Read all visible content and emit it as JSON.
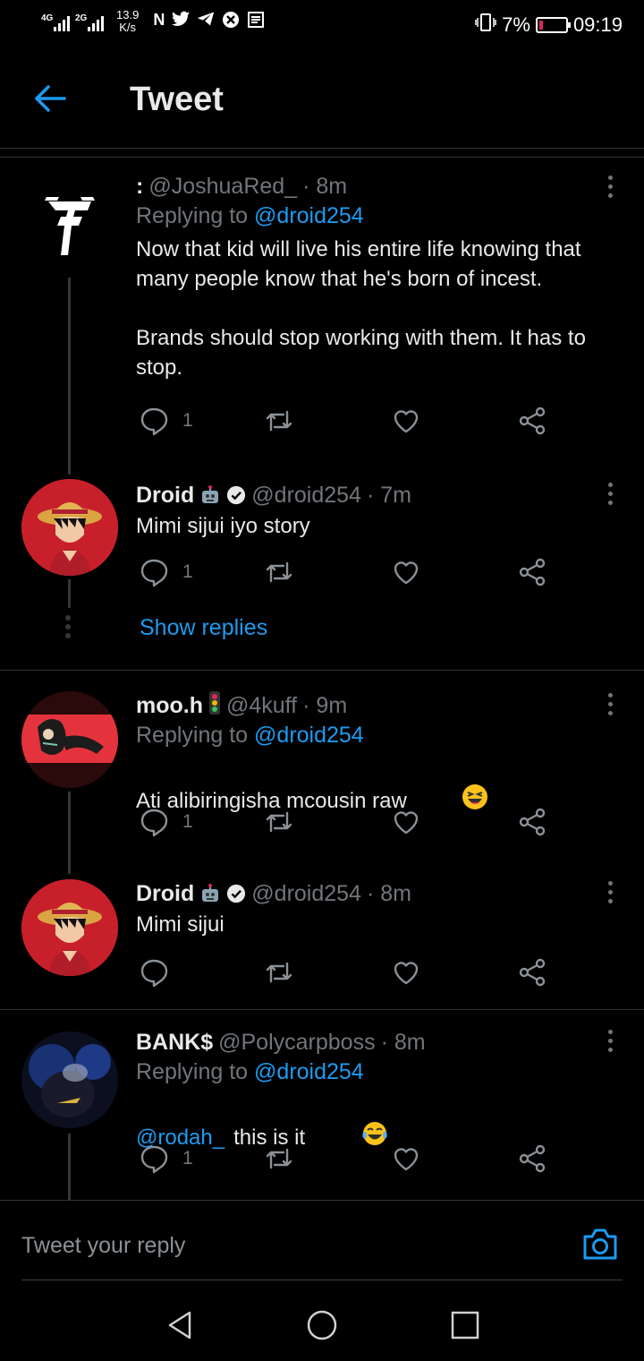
{
  "status_bar": {
    "net1": "4G",
    "net2": "2G",
    "speed_value": "13.9",
    "speed_unit": "K/s",
    "battery": "7%",
    "time": "09:19",
    "icons": [
      "n-icon",
      "twitter-icon",
      "telegram-icon",
      "blocked-icon",
      "news-icon"
    ]
  },
  "header": {
    "title": "Tweet"
  },
  "tweets": [
    {
      "name": ":",
      "handle": "@JoshuaRed_",
      "time": "· 8m",
      "replying_prefix": "Replying to",
      "replying_to": "@droid254",
      "text": "Now that kid will live his entire life knowing that many people know that he's born of incest.\n\nBrands should stop working with them. It has to stop.",
      "reply_count": "1"
    },
    {
      "name": "Droid",
      "handle": "@droid254",
      "time": "· 7m",
      "text": "Mimi sijui iyo story",
      "reply_count": "1"
    },
    {
      "name": "moo.h",
      "handle": "@4kuff",
      "time": "· 9m",
      "replying_prefix": "Replying to",
      "replying_to": "@droid254",
      "text": "Ati alibiringisha mcousin raw",
      "reply_count": "1"
    },
    {
      "name": "Droid",
      "handle": "@droid254",
      "time": "· 8m",
      "text": "Mimi sijui",
      "reply_count": ""
    },
    {
      "name": "BANK$",
      "handle": "@Polycarpboss",
      "time": "· 8m",
      "replying_prefix": "Replying to",
      "replying_to": "@droid254",
      "mention": "@rodah_",
      "text": "this is it",
      "reply_count": "1"
    }
  ],
  "show_replies_label": "Show replies",
  "reply_bar": {
    "placeholder": "Tweet your reply"
  },
  "colors": {
    "accent": "#1d9bf0",
    "background": "#000000",
    "muted": "#71767b"
  }
}
